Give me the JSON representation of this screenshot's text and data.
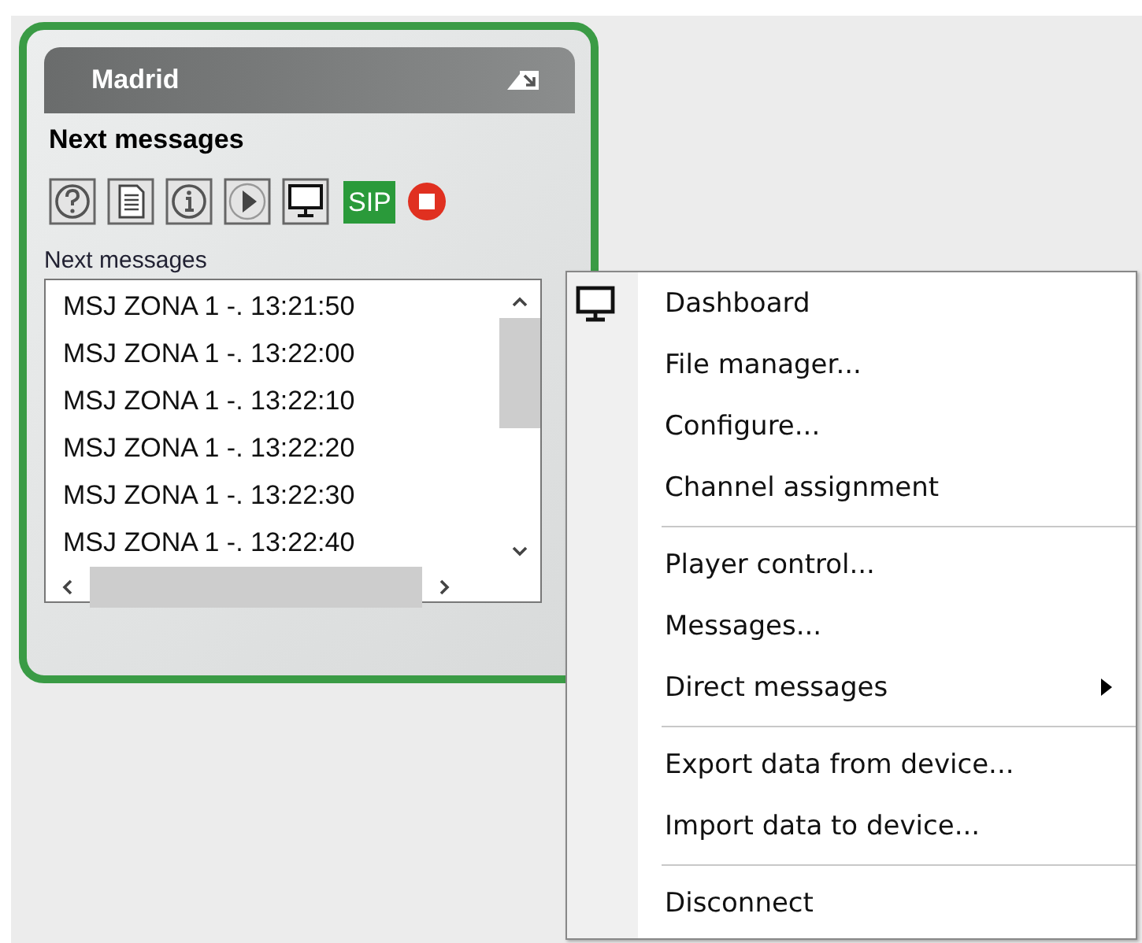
{
  "panel": {
    "title": "Madrid",
    "heading": "Next messages",
    "toolbar": [
      {
        "kind": "help"
      },
      {
        "kind": "document"
      },
      {
        "kind": "info"
      },
      {
        "kind": "play"
      },
      {
        "kind": "monitor"
      },
      {
        "kind": "sip",
        "label": "SIP"
      },
      {
        "kind": "stop"
      }
    ],
    "list_label": "Next messages",
    "messages": [
      "MSJ ZONA 1 -. 13:21:50",
      "MSJ ZONA 1 -. 13:22:00",
      "MSJ ZONA 1 -. 13:22:10",
      "MSJ ZONA 1 -. 13:22:20",
      "MSJ ZONA 1 -. 13:22:30",
      "MSJ ZONA 1 -. 13:22:40"
    ]
  },
  "context_menu": {
    "groups": [
      [
        {
          "label": "Dashboard",
          "kind": "monitor"
        },
        {
          "label": "File manager...",
          "kind": "plain"
        },
        {
          "label": "Configure...",
          "kind": "plain"
        },
        {
          "label": "Channel assignment",
          "kind": "plain"
        }
      ],
      [
        {
          "label": "Player control...",
          "kind": "plain"
        },
        {
          "label": "Messages...",
          "kind": "plain"
        },
        {
          "label": "Direct messages",
          "kind": "submenu"
        }
      ],
      [
        {
          "label": "Export data from device...",
          "kind": "plain"
        },
        {
          "label": "Import data to device...",
          "kind": "plain"
        }
      ],
      [
        {
          "label": "Disconnect",
          "kind": "plain"
        }
      ]
    ]
  }
}
